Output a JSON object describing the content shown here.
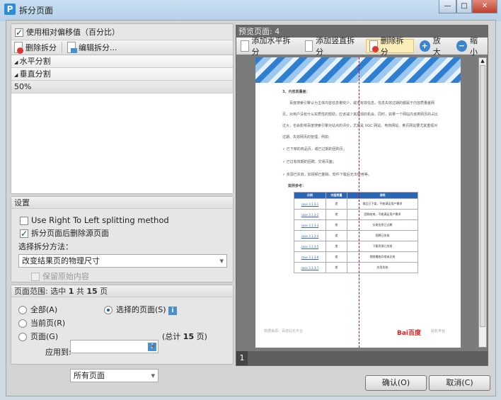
{
  "window": {
    "title": "拆分页面",
    "app_icon": "P",
    "controls": [
      "minimize",
      "maximize",
      "close"
    ]
  },
  "left": {
    "use_relative_offset": {
      "label": "使用相对偏移值（百分比）",
      "checked": true
    },
    "toolbar": {
      "delete": "删除拆分",
      "edit": "编辑拆分..."
    },
    "splits": [
      {
        "label": "水平分割",
        "expandable": true
      },
      {
        "label": "垂直分割",
        "expandable": true
      },
      {
        "label": "50%"
      }
    ],
    "settings": {
      "title": "设置",
      "rtl": {
        "label": "Use Right To Left splitting method",
        "checked": false
      },
      "delete_source": {
        "label": "拆分页面后删除源页面",
        "checked": true
      },
      "method_label": "选择拆分方法：",
      "method_value": "改变结果页的物理尺寸",
      "keep_original": {
        "label": "保留原始内容",
        "checked": false,
        "disabled": true
      }
    },
    "range": {
      "title_prefix": "页面范围: 选中",
      "selected": "1",
      "of": "共",
      "total": "15",
      "unit": "页",
      "all": "全部(A)",
      "current": "当前页(R)",
      "pages": "页面(G)",
      "selected_pages": "选择的页面(S)",
      "pages_value": "",
      "total_prefix": "(总计",
      "total_suffix": "页)",
      "apply_label": "应用到:",
      "apply_value": "所有页面",
      "choice": "selected_pages"
    }
  },
  "preview": {
    "title": "预览页面: 4",
    "toolbar": {
      "add_h": "添加水平拆分",
      "add_v": "添加竖直拆分",
      "delete": "删除拆分",
      "zoom_in": "放大",
      "zoom_out": "缩小"
    },
    "page_number": "1",
    "doc": {
      "heading": "3、内容质量差：",
      "paragraphs": [
        "百度搜索引擎认为主体内容信息量较少，或无有效信息，信息失效过期的都属于内容质量差网页，对用户没有什么实质性的帮助，应该减少其展现的机会。同时，如果一个网站内该类网页的占比过大，也会影响百度搜索引擎对站点的评价，尤其是 UGC 网站、电商网站、黄页网站要尤其重视对过期、失效网页的管理。例如："
      ],
      "bullets": [
        "已下架的商品页，或已过期的团购页；",
        "已过有效期的招聘、交易页面；",
        "资源已失效，如视频已删除、软件下载后无法使用等。"
      ],
      "cases_title": "案例参考：",
      "table_headers": [
        "示例",
        "内容质量",
        "说明"
      ],
      "table_rows": [
        [
          "case 3.1.3-1",
          "差",
          "商品已下架，不能满足用户需求"
        ],
        [
          "case 3.1.3-2",
          "差",
          "团购结束，不能满足用户需求"
        ],
        [
          "case 3.1.3-3",
          "差",
          "交易信息已过期"
        ],
        [
          "case 3.1.3-4",
          "差",
          "招聘已失效"
        ],
        [
          "case 3.1.3-5",
          "差",
          "下载资源已失效"
        ],
        [
          "case 3.1.3-6",
          "差",
          "视频播放异常或无效"
        ],
        [
          "case 3.1.3-7",
          "差",
          "应用失效"
        ]
      ],
      "footer_left": "数据来源：百度站长平台",
      "footer_logo": "Bai百度",
      "footer_right": "站长平台"
    }
  },
  "buttons": {
    "ok": "确认(O)",
    "cancel": "取消(C)"
  }
}
